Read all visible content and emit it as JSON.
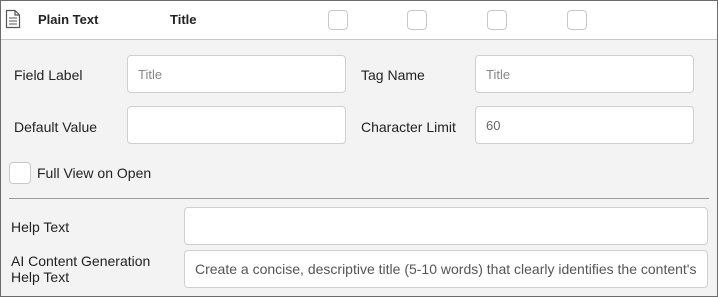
{
  "header": {
    "field_type": "Plain Text",
    "field_name": "Title"
  },
  "fields": {
    "field_label": {
      "label": "Field Label",
      "placeholder": "Title",
      "value": ""
    },
    "tag_name": {
      "label": "Tag Name",
      "placeholder": "Title",
      "value": ""
    },
    "default_value": {
      "label": "Default Value",
      "value": ""
    },
    "character_limit": {
      "label": "Character Limit",
      "value": "60"
    }
  },
  "full_view": {
    "label": "Full View on Open",
    "checked": false
  },
  "help_text": {
    "label": "Help Text",
    "value": ""
  },
  "ai_help": {
    "label": "AI Content Generation Help Text",
    "value": "Create a concise, descriptive title (5-10 words) that clearly identifies the content's"
  },
  "icons": {
    "document": "document-icon"
  },
  "colors": {
    "panel_bg": "#f3f3f3",
    "border": "#6b6b6b"
  }
}
